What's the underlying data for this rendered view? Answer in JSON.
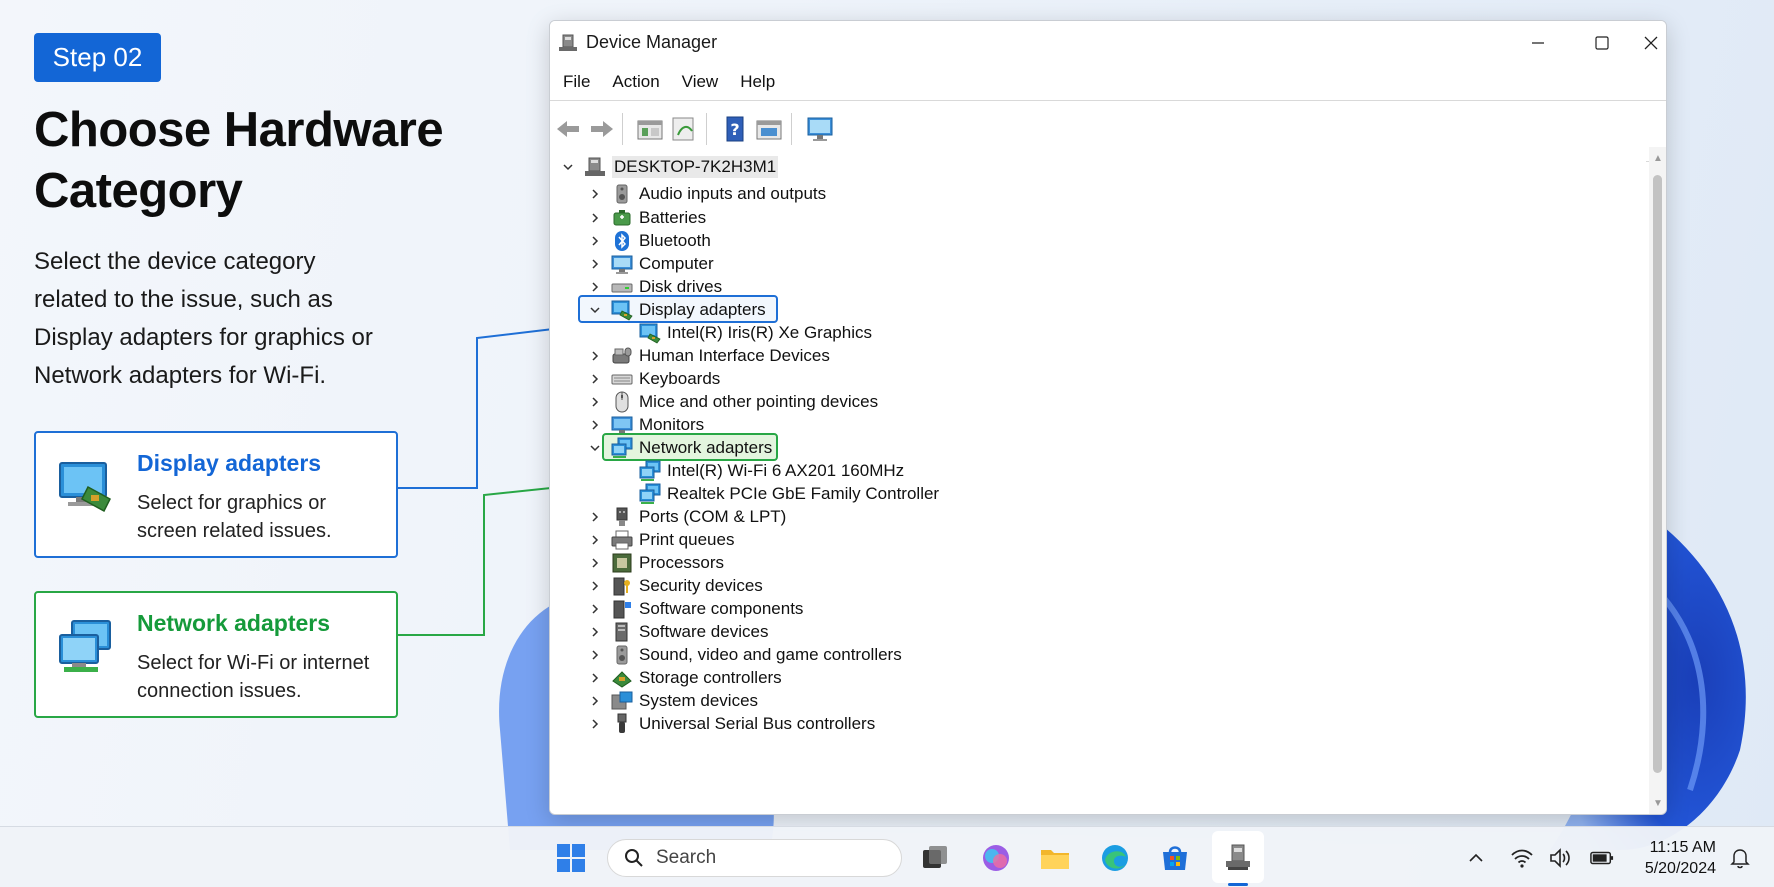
{
  "step_badge": "Step 02",
  "headline": "Choose Hardware Category",
  "description": "Select the device category related to the issue, such as Display adapters for graphics or Network adapters for Wi-Fi.",
  "callouts": {
    "display": {
      "title": "Display adapters",
      "desc": "Select for graphics or screen related issues.",
      "color": "#1366d6"
    },
    "network": {
      "title": "Network adapters",
      "desc": "Select for Wi-Fi or internet connection issues.",
      "color": "#159a3a"
    }
  },
  "window": {
    "title": "Device Manager",
    "controls": [
      "minimize-icon",
      "maximize-icon",
      "close-icon"
    ],
    "menu": [
      "File",
      "Action",
      "View",
      "Help"
    ],
    "toolbar_icons": [
      "back-arrow-icon",
      "forward-arrow-icon",
      "properties-icon",
      "update-driver-icon",
      "help-icon",
      "show-hidden-icon",
      "scan-hardware-icon"
    ]
  },
  "tree": {
    "root": "DESKTOP-7K2H3M1",
    "items": [
      {
        "label": "Audio inputs and outputs",
        "icon": "speaker-icon",
        "expanded": false
      },
      {
        "label": "Batteries",
        "icon": "battery-icon",
        "expanded": false
      },
      {
        "label": "Bluetooth",
        "icon": "bluetooth-icon",
        "expanded": false
      },
      {
        "label": "Computer",
        "icon": "computer-icon",
        "expanded": false
      },
      {
        "label": "Disk drives",
        "icon": "disk-drive-icon",
        "expanded": false
      },
      {
        "label": "Display adapters",
        "icon": "display-adapter-icon",
        "expanded": true,
        "highlight": "blue",
        "children": [
          {
            "label": "Intel(R) Iris(R) Xe Graphics",
            "icon": "display-adapter-icon"
          }
        ]
      },
      {
        "label": "Human Interface Devices",
        "icon": "hid-icon",
        "expanded": false
      },
      {
        "label": "Keyboards",
        "icon": "keyboard-icon",
        "expanded": false
      },
      {
        "label": "Mice and other pointing devices",
        "icon": "mouse-icon",
        "expanded": false
      },
      {
        "label": "Monitors",
        "icon": "monitor-icon",
        "expanded": false
      },
      {
        "label": "Network adapters",
        "icon": "network-adapter-icon",
        "expanded": true,
        "highlight": "green",
        "children": [
          {
            "label": "Intel(R) Wi-Fi 6 AX201 160MHz",
            "icon": "network-adapter-icon"
          },
          {
            "label": "Realtek PCIe GbE Family Controller",
            "icon": "network-adapter-icon"
          }
        ]
      },
      {
        "label": "Ports (COM & LPT)",
        "icon": "port-icon",
        "expanded": false
      },
      {
        "label": "Print queues",
        "icon": "printer-icon",
        "expanded": false
      },
      {
        "label": "Processors",
        "icon": "processor-icon",
        "expanded": false
      },
      {
        "label": "Security devices",
        "icon": "security-icon",
        "expanded": false
      },
      {
        "label": "Software components",
        "icon": "software-component-icon",
        "expanded": false
      },
      {
        "label": "Software devices",
        "icon": "software-device-icon",
        "expanded": false
      },
      {
        "label": "Sound, video and game controllers",
        "icon": "speaker-icon",
        "expanded": false
      },
      {
        "label": "Storage controllers",
        "icon": "storage-controller-icon",
        "expanded": false
      },
      {
        "label": "System devices",
        "icon": "system-device-icon",
        "expanded": false
      },
      {
        "label": "Universal Serial Bus controllers",
        "icon": "usb-icon",
        "expanded": false
      }
    ]
  },
  "taskbar": {
    "search_label": "Search",
    "apps": [
      "start-icon",
      "task-view-icon",
      "copilot-icon",
      "file-explorer-icon",
      "edge-icon",
      "store-icon",
      "device-manager-icon"
    ],
    "tray": [
      "chevron-up-icon",
      "wifi-icon",
      "volume-icon",
      "battery-icon",
      "notification-bell-icon"
    ],
    "time": "11:15 AM",
    "date": "5/20/2024"
  },
  "colors": {
    "accent_blue": "#1366d6",
    "accent_green": "#28a745"
  }
}
